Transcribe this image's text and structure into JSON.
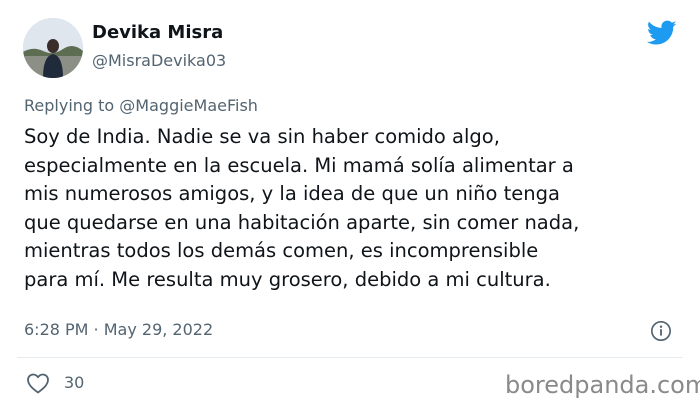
{
  "author": {
    "name": "Devika Misra",
    "handle": "@MisraDevika03"
  },
  "reply": {
    "prefix": "Replying to ",
    "to": "@MaggieMaeFish"
  },
  "tweet": {
    "lines": [
      "Soy de India. Nadie se va sin haber comido algo,",
      "especialmente en la escuela. Mi mamá solía alimentar a",
      "mis numerosos amigos, y la idea de que un niño tenga",
      "que quedarse en una habitación aparte, sin comer nada,",
      "mientras todos los demás comen, es incomprensible",
      "para mí. Me resulta muy grosero, debido a mi cultura."
    ]
  },
  "meta": {
    "time": "6:28 PM",
    "separator": " · ",
    "date": "May 29, 2022"
  },
  "stats": {
    "likes": "30"
  },
  "watermark": {
    "text": "boredpanda.com"
  },
  "icons": {
    "brand": "twitter-bird-icon",
    "info": "info-icon",
    "like": "heart-icon"
  },
  "colors": {
    "twitter_blue": "#1d9bf0",
    "secondary_text": "#536471",
    "primary_text": "#0f1419"
  }
}
